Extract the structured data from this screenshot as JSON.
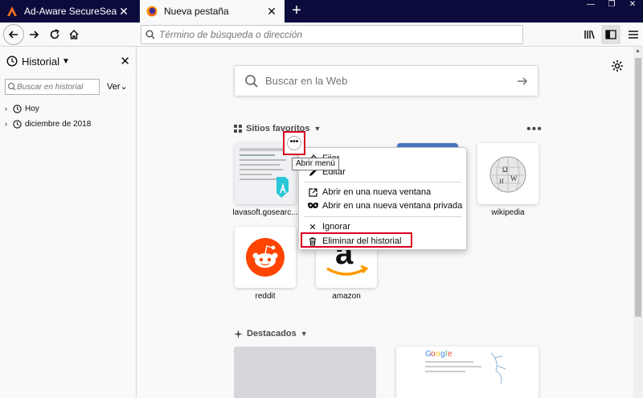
{
  "tabs": [
    {
      "label": "Ad-Aware SecureSearch",
      "icon": "adaware-logo-icon"
    },
    {
      "label": "Nueva pestaña",
      "icon": "firefox-icon"
    }
  ],
  "urlbar": {
    "placeholder": "Término de búsqueda o dirección"
  },
  "sidebar": {
    "title": "Historial",
    "search_placeholder": "Buscar en historial",
    "view_label": "Ver",
    "items": [
      {
        "label": "Hoy"
      },
      {
        "label": "diciembre de 2018"
      }
    ]
  },
  "newtab": {
    "search_placeholder": "Buscar en la Web",
    "topsites_title": "Sitios favoritos",
    "highlights_title": "Destacados",
    "tiles": [
      {
        "label": "lavasoft.gosearc..."
      },
      {
        "label": "wikipedia"
      },
      {
        "label": "reddit"
      },
      {
        "label": "amazon"
      }
    ]
  },
  "context_menu": {
    "items": [
      {
        "label": "Fijar",
        "icon": "pin-icon"
      },
      {
        "label": "Editar",
        "icon": "pencil-icon"
      },
      {
        "label": "Abrir en una nueva ventana",
        "icon": "new-window-icon"
      },
      {
        "label": "Abrir en una nueva ventana privada",
        "icon": "private-mask-icon"
      },
      {
        "label": "Ignorar",
        "icon": "close-icon"
      },
      {
        "label": "Eliminar del historial",
        "icon": "trash-icon"
      }
    ]
  },
  "tooltip": "Abrir menú",
  "colors": {
    "tabstrip": "#0c0c3c",
    "highlight_red": "#d70022",
    "reddit_orange": "#ff4500",
    "amazon_orange": "#ff9900"
  }
}
